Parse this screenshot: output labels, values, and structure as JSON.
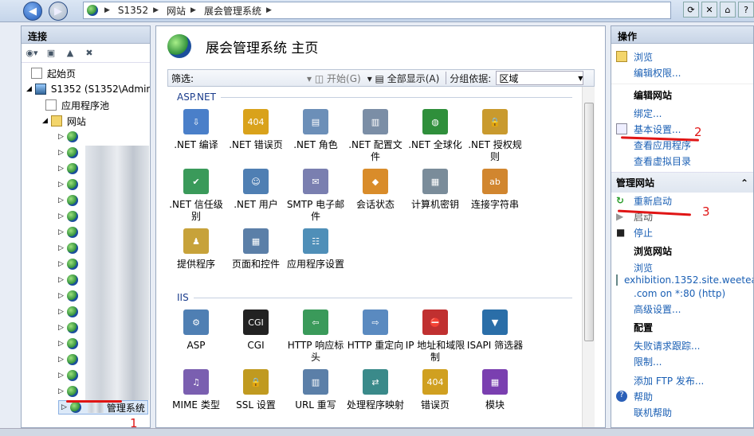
{
  "addressbar": {
    "crumbs": [
      "S1352",
      "网站",
      "展会管理系统"
    ]
  },
  "left": {
    "title": "连接",
    "tree": {
      "start": "起始页",
      "server": "S1352 (S1352\\Admin",
      "apppools": "应用程序池",
      "sites": "网站",
      "selected": "管理系统"
    },
    "annotation": "1"
  },
  "center": {
    "title": "展会管理系统 主页",
    "filter": {
      "label": "筛选:",
      "go": "开始(G)",
      "showall": "全部显示(A)",
      "groupby_label": "分组依据:",
      "groupby_value": "区域"
    },
    "sections": [
      {
        "name": "ASP.NET",
        "items": [
          ".NET 编译",
          ".NET 错误页",
          ".NET 角色",
          ".NET 配置文件",
          ".NET 全球化",
          ".NET 授权规则",
          ".NET 信任级别",
          ".NET 用户",
          "SMTP 电子邮件",
          "会话状态",
          "计算机密钥",
          "连接字符串",
          "提供程序",
          "页面和控件",
          "应用程序设置"
        ]
      },
      {
        "name": "IIS",
        "items": [
          "ASP",
          "CGI",
          "HTTP 响应标头",
          "HTTP 重定向",
          "IP 地址和域限制",
          "ISAPI 筛选器",
          "MIME 类型",
          "SSL 设置",
          "URL 重写",
          "处理程序映射",
          "错误页",
          "模块"
        ]
      }
    ]
  },
  "right": {
    "title": "操作",
    "explore": "浏览",
    "edit_perms": "编辑权限...",
    "edit_site": "编辑网站",
    "bindings": "绑定...",
    "basic_settings": "基本设置...",
    "view_apps": "查看应用程序",
    "view_vdirs": "查看虚拟目录",
    "manage_site": "管理网站",
    "restart": "重新启动",
    "start": "启动",
    "stop": "停止",
    "browse_site": "浏览网站",
    "browse": "浏览",
    "browse_url": "exhibition.1352.site.weetea",
    "browse_url2": ".com on *:80 (http)",
    "advanced": "高级设置...",
    "config": "配置",
    "failed_req": "失败请求跟踪...",
    "limits": "限制...",
    "add_ftp": "添加 FTP 发布...",
    "help": "帮助",
    "online_help": "联机帮助",
    "annotation2": "2",
    "annotation3": "3"
  }
}
